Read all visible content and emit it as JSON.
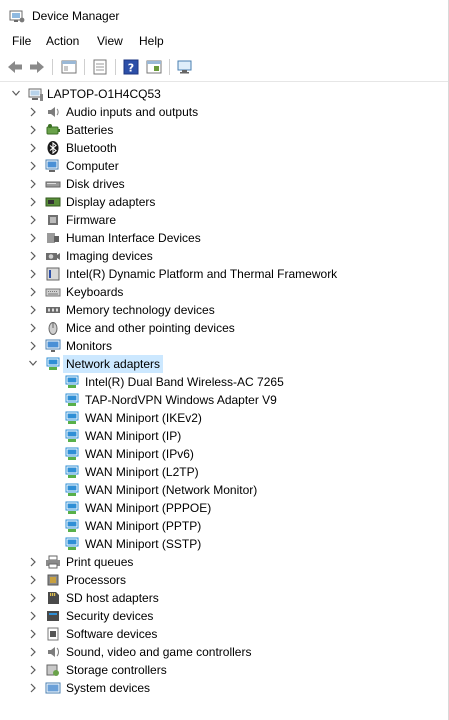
{
  "window": {
    "title": "Device Manager"
  },
  "menu": [
    "File",
    "Action",
    "View",
    "Help"
  ],
  "toolbar": {
    "buttons": [
      "back-icon",
      "forward-icon",
      "show-hide-tree-icon",
      "properties-icon",
      "help-icon",
      "update-driver-icon",
      "scan-hardware-icon"
    ]
  },
  "tree": {
    "root": "LAPTOP-O1H4CQ53",
    "categories": [
      {
        "label": "Audio inputs and outputs",
        "icon": "speaker-icon",
        "expanded": false
      },
      {
        "label": "Batteries",
        "icon": "battery-icon",
        "expanded": false
      },
      {
        "label": "Bluetooth",
        "icon": "bluetooth-icon",
        "expanded": false
      },
      {
        "label": "Computer",
        "icon": "computer-icon",
        "expanded": false
      },
      {
        "label": "Disk drives",
        "icon": "disk-drive-icon",
        "expanded": false
      },
      {
        "label": "Display adapters",
        "icon": "display-adapter-icon",
        "expanded": false
      },
      {
        "label": "Firmware",
        "icon": "firmware-icon",
        "expanded": false
      },
      {
        "label": "Human Interface Devices",
        "icon": "hid-icon",
        "expanded": false
      },
      {
        "label": "Imaging devices",
        "icon": "camera-icon",
        "expanded": false
      },
      {
        "label": "Intel(R) Dynamic Platform and Thermal Framework",
        "icon": "thermal-framework-icon",
        "expanded": false
      },
      {
        "label": "Keyboards",
        "icon": "keyboard-icon",
        "expanded": false
      },
      {
        "label": "Memory technology devices",
        "icon": "memory-icon",
        "expanded": false
      },
      {
        "label": "Mice and other pointing devices",
        "icon": "mouse-icon",
        "expanded": false
      },
      {
        "label": "Monitors",
        "icon": "monitor-icon",
        "expanded": false
      },
      {
        "label": "Network adapters",
        "icon": "network-adapter-icon",
        "expanded": true,
        "selected": true,
        "children": [
          "Intel(R) Dual Band Wireless-AC 7265",
          "TAP-NordVPN Windows Adapter V9",
          "WAN Miniport (IKEv2)",
          "WAN Miniport (IP)",
          "WAN Miniport (IPv6)",
          "WAN Miniport (L2TP)",
          "WAN Miniport (Network Monitor)",
          "WAN Miniport (PPPOE)",
          "WAN Miniport (PPTP)",
          "WAN Miniport (SSTP)"
        ]
      },
      {
        "label": "Print queues",
        "icon": "printer-icon",
        "expanded": false
      },
      {
        "label": "Processors",
        "icon": "processor-icon",
        "expanded": false
      },
      {
        "label": "SD host adapters",
        "icon": "sd-card-icon",
        "expanded": false
      },
      {
        "label": "Security devices",
        "icon": "security-device-icon",
        "expanded": false
      },
      {
        "label": "Software devices",
        "icon": "software-device-icon",
        "expanded": false
      },
      {
        "label": "Sound, video and game controllers",
        "icon": "sound-controller-icon",
        "expanded": false
      },
      {
        "label": "Storage controllers",
        "icon": "storage-controller-icon",
        "expanded": false
      },
      {
        "label": "System devices",
        "icon": "system-device-icon",
        "expanded": false
      }
    ]
  },
  "colors": {
    "selection": "#cce8ff",
    "chevron": "#5a5a5a",
    "network_icon": "#2f8fd6"
  }
}
